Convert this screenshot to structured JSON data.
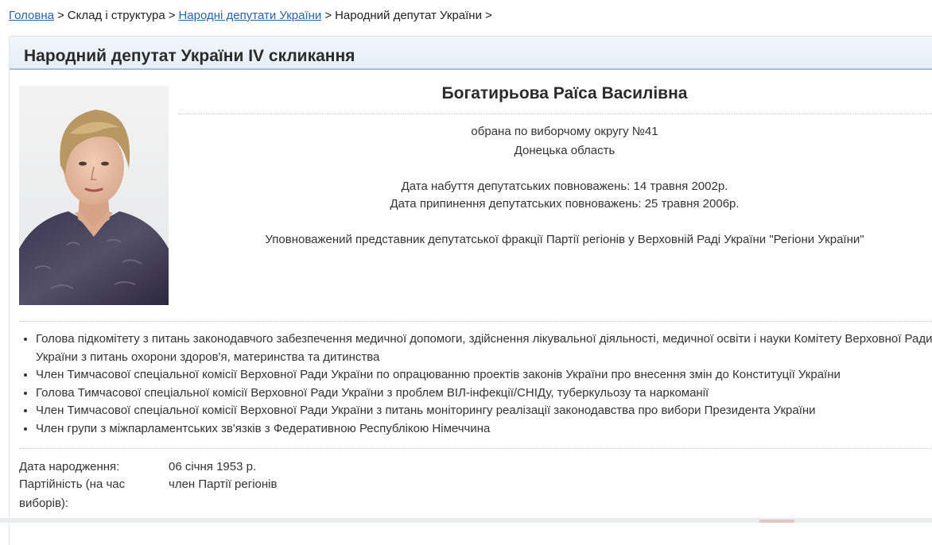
{
  "breadcrumb": {
    "items": [
      {
        "label": "Головна",
        "link": true
      },
      {
        "label": "Склад і структура",
        "link": false
      },
      {
        "label": "Народні депутати України",
        "link": true
      },
      {
        "label": "Народний депутат України",
        "link": false
      }
    ],
    "separator": ">"
  },
  "page": {
    "title": "Народний депутат України IV скликання"
  },
  "deputy": {
    "name": "Богатирьова Раїса Василівна",
    "district": "обрана по виборчому округу №41",
    "region": "Донецька область",
    "mandate_start": "Дата набуття депутатських повноважень: 14 травня 2002р.",
    "mandate_end": "Дата припинення депутатських повноважень: 25 травня 2006р.",
    "faction_role": "Уповноважений представник депутатської фракції Партії регіонів у Верховній Раді України \"Регіони України\""
  },
  "positions": [
    "Голова підкомітету з питань законодавчого забезпечення медичної допомоги, здійснення лікувальної діяльності, медичної освіти і науки Комітету Верховної Ради України з питань охорони здоров'я, материнства та дитинства",
    "Член Тимчасової спеціальної комісії Верховної Ради України по опрацюванню проектів законів України про внесення змін до Конституції України",
    "Голова Тимчасової спеціальної комісії Верховної Ради України з проблем ВІЛ-інфекції/СНІДу, туберкульозу та наркоманії",
    "Член Тимчасової спеціальної комісії Верховної Ради України з питань моніторингу реалізації законодавства про вибори Президента України",
    "Член групи з міжпарламентських зв'язків з Федеративною Республікою Німеччина"
  ],
  "details": [
    {
      "label": "Дата народження:",
      "value": "06 січня 1953 р."
    },
    {
      "label": "Партійність (на час виборів):",
      "value": "член Партії регіонів"
    }
  ],
  "colors": {
    "link": "#2a64a8",
    "header_border": "#9cc2e0"
  }
}
